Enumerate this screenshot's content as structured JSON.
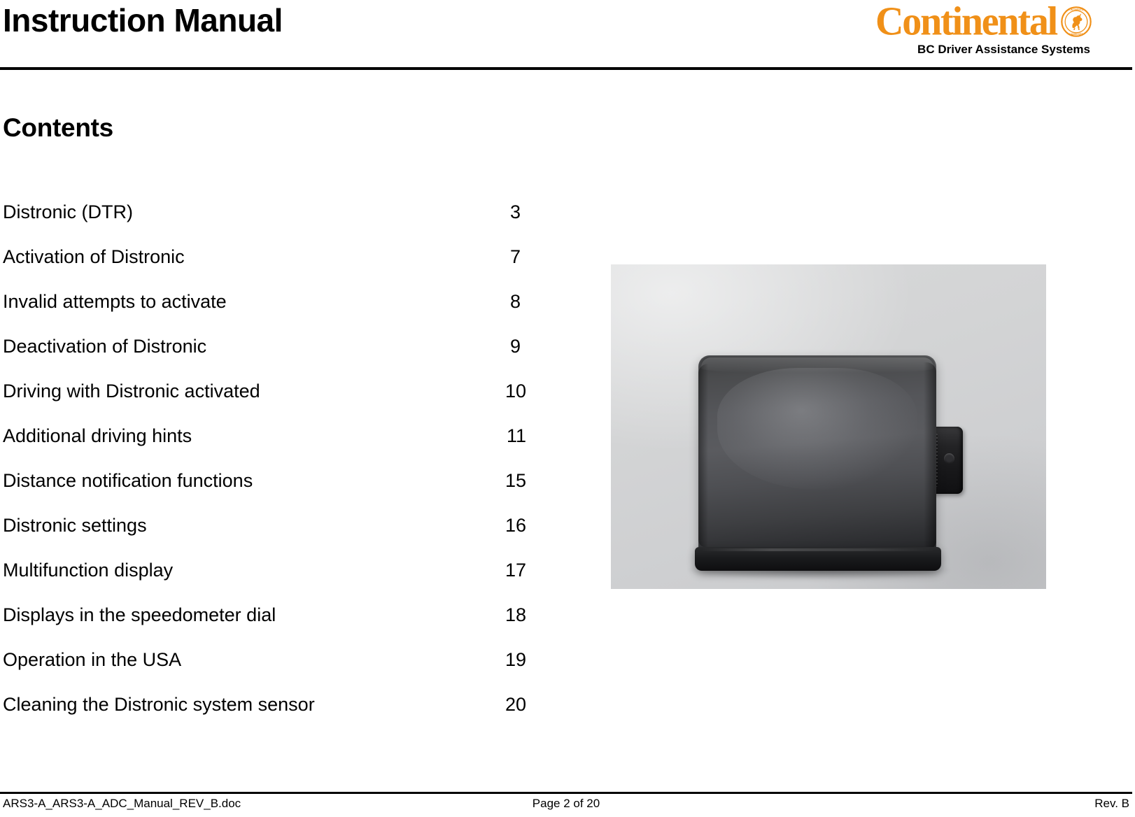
{
  "header": {
    "title": "Instruction Manual",
    "brand_wordmark": "Continental",
    "brand_emblem_icon": "continental-horse-emblem-icon",
    "brand_subtitle": "BC Driver Assistance Systems",
    "brand_color": "#F09018"
  },
  "contents": {
    "heading": "Contents",
    "entries": [
      {
        "label": "Distronic (DTR)",
        "page": "3"
      },
      {
        "label": "Activation of Distronic",
        "page": "7"
      },
      {
        "label": "Invalid attempts to activate",
        "page": "8"
      },
      {
        "label": "Deactivation of Distronic",
        "page": "9"
      },
      {
        "label": "Driving with Distronic activated",
        "page": "10"
      },
      {
        "label": "Additional driving hints",
        "page": "11"
      },
      {
        "label": "Distance notification functions",
        "page": "15"
      },
      {
        "label": "Distronic settings",
        "page": "16"
      },
      {
        "label": "Multifunction display",
        "page": "17"
      },
      {
        "label": "Displays in the speedometer dial",
        "page": "18"
      },
      {
        "label": "Operation in the USA",
        "page": "19"
      },
      {
        "label": "Cleaning the Distronic system sensor",
        "page": "20"
      }
    ]
  },
  "photo": {
    "name": "distronic-radar-sensor-photo",
    "background_color": "#d2d3d4",
    "device_color": "#4a4b4d"
  },
  "footer": {
    "filename": "ARS3-A_ARS3-A_ADC_Manual_REV_B.doc",
    "page_indicator": "Page 2 of 20",
    "revision": "Rev. B"
  }
}
